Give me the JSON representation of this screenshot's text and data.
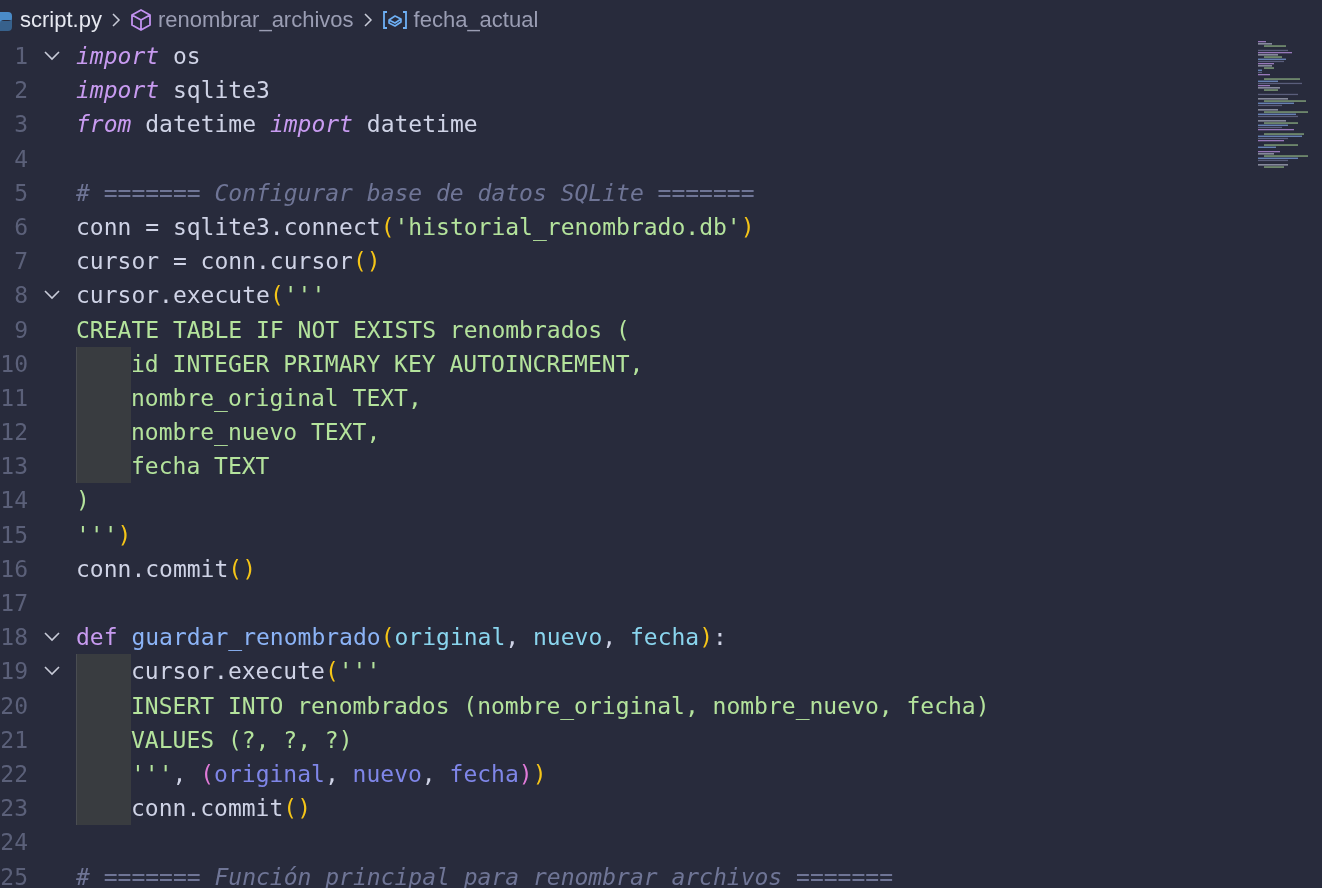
{
  "breadcrumb": [
    {
      "kind": "file",
      "label": "script.py"
    },
    {
      "kind": "module",
      "label": "renombrar_archivos"
    },
    {
      "kind": "variable",
      "label": "fecha_actual"
    }
  ],
  "lines": [
    {
      "number": "1",
      "expanded": true,
      "tokens": [
        {
          "kind": "kw",
          "text": "import"
        },
        {
          "kind": "plain",
          "text": " os"
        }
      ]
    },
    {
      "number": "2",
      "tokens": [
        {
          "kind": "kw",
          "text": "import"
        },
        {
          "kind": "plain",
          "text": " sqlite3"
        }
      ]
    },
    {
      "number": "3",
      "tokens": [
        {
          "kind": "kw",
          "text": "from"
        },
        {
          "kind": "plain",
          "text": " datetime "
        },
        {
          "kind": "kw",
          "text": "import"
        },
        {
          "kind": "plain",
          "text": " datetime"
        }
      ]
    },
    {
      "number": "4"
    },
    {
      "number": "5",
      "tokens": [
        {
          "kind": "cmt",
          "text": "# ======= Configurar base de datos SQLite ======="
        }
      ]
    },
    {
      "number": "6",
      "tokens": [
        {
          "kind": "plain",
          "text": "conn = sqlite3.connect"
        },
        {
          "kind": "br1",
          "text": "("
        },
        {
          "kind": "str",
          "text": "'historial_renombrado.db'"
        },
        {
          "kind": "br1",
          "text": ")"
        }
      ]
    },
    {
      "number": "7",
      "tokens": [
        {
          "kind": "plain",
          "text": "cursor = conn.cursor"
        },
        {
          "kind": "br1",
          "text": "()"
        }
      ]
    },
    {
      "number": "8",
      "expanded": true,
      "tokens": [
        {
          "kind": "plain",
          "text": "cursor.execute"
        },
        {
          "kind": "br1",
          "text": "("
        },
        {
          "kind": "str",
          "text": "'''"
        }
      ]
    },
    {
      "number": "9",
      "tokens": [
        {
          "kind": "str",
          "text": "CREATE TABLE IF NOT EXISTS renombrados ("
        }
      ]
    },
    {
      "number": "10",
      "indented": true,
      "tokens": [
        {
          "kind": "str",
          "text": "id INTEGER PRIMARY KEY AUTOINCREMENT,"
        }
      ]
    },
    {
      "number": "11",
      "indented": true,
      "tokens": [
        {
          "kind": "str",
          "text": "nombre_original TEXT,"
        }
      ]
    },
    {
      "number": "12",
      "indented": true,
      "tokens": [
        {
          "kind": "str",
          "text": "nombre_nuevo TEXT,"
        }
      ]
    },
    {
      "number": "13",
      "indented": true,
      "tokens": [
        {
          "kind": "str",
          "text": "fecha TEXT"
        }
      ]
    },
    {
      "number": "14",
      "tokens": [
        {
          "kind": "str",
          "text": ")"
        }
      ]
    },
    {
      "number": "15",
      "tokens": [
        {
          "kind": "str",
          "text": "'''"
        },
        {
          "kind": "br1",
          "text": ")"
        }
      ]
    },
    {
      "number": "16",
      "tokens": [
        {
          "kind": "plain",
          "text": "conn.commit"
        },
        {
          "kind": "br1",
          "text": "()"
        }
      ]
    },
    {
      "number": "17"
    },
    {
      "number": "18",
      "expanded": true,
      "tokens": [
        {
          "kind": "def",
          "text": "def"
        },
        {
          "kind": "fn",
          "text": " guardar_renombrado"
        },
        {
          "kind": "br1",
          "text": "("
        },
        {
          "kind": "param",
          "text": "original"
        },
        {
          "kind": "plain",
          "text": ", "
        },
        {
          "kind": "param",
          "text": "nuevo"
        },
        {
          "kind": "plain",
          "text": ", "
        },
        {
          "kind": "param",
          "text": "fecha"
        },
        {
          "kind": "br1",
          "text": ")"
        },
        {
          "kind": "plain",
          "text": ":"
        }
      ]
    },
    {
      "number": "19",
      "expanded": true,
      "indented": true,
      "tokens": [
        {
          "kind": "plain",
          "text": "cursor.execute"
        },
        {
          "kind": "br1",
          "text": "("
        },
        {
          "kind": "str",
          "text": "'''"
        }
      ]
    },
    {
      "number": "20",
      "indented": true,
      "tokens": [
        {
          "kind": "str",
          "text": "INSERT INTO renombrados (nombre_original, nombre_nuevo, fecha)"
        }
      ]
    },
    {
      "number": "21",
      "indented": true,
      "tokens": [
        {
          "kind": "str",
          "text": "VALUES (?, ?, ?)"
        }
      ]
    },
    {
      "number": "22",
      "indented": true,
      "tokens": [
        {
          "kind": "str",
          "text": "'''"
        },
        {
          "kind": "plain",
          "text": ", "
        },
        {
          "kind": "br2",
          "text": "("
        },
        {
          "kind": "var",
          "text": "original"
        },
        {
          "kind": "plain",
          "text": ", "
        },
        {
          "kind": "var",
          "text": "nuevo"
        },
        {
          "kind": "plain",
          "text": ", "
        },
        {
          "kind": "var",
          "text": "fecha"
        },
        {
          "kind": "br2",
          "text": ")"
        },
        {
          "kind": "br1",
          "text": ")"
        }
      ]
    },
    {
      "number": "23",
      "indented": true,
      "tokens": [
        {
          "kind": "plain",
          "text": "conn.commit"
        },
        {
          "kind": "br1",
          "text": "()"
        }
      ]
    },
    {
      "number": "24"
    },
    {
      "number": "25",
      "tokens": [
        {
          "kind": "cmt",
          "text": "# ======= Función principal para renombrar archivos ======="
        }
      ]
    }
  ]
}
